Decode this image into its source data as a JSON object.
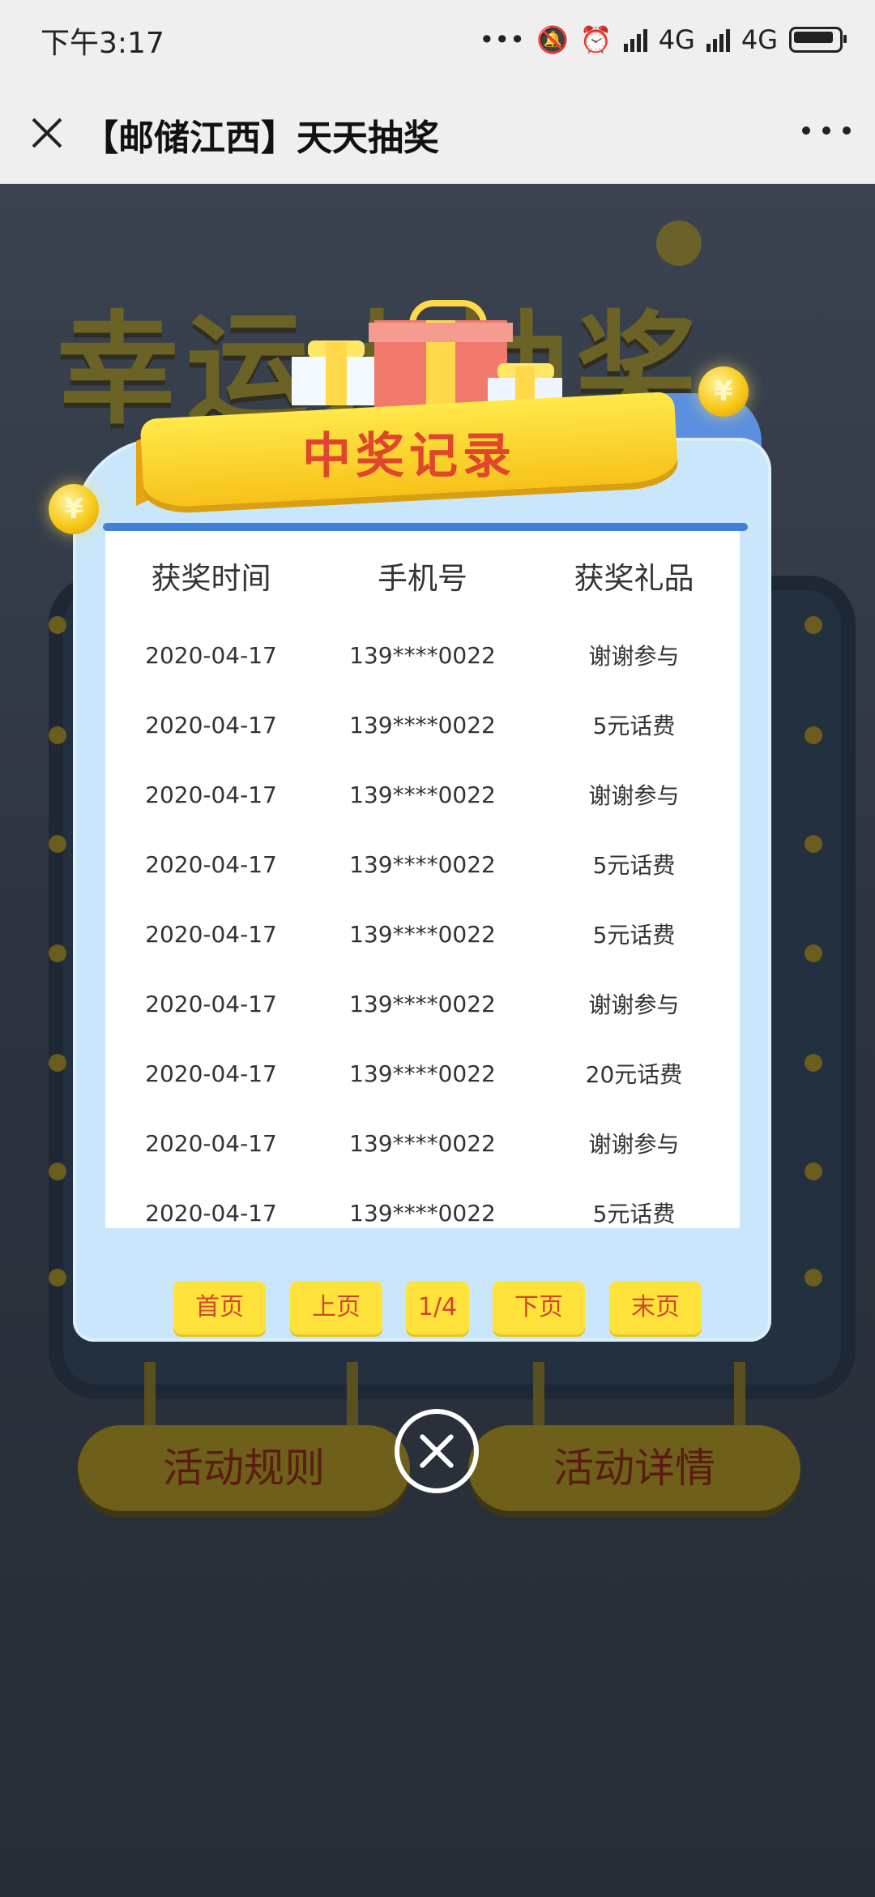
{
  "status_bar": {
    "time": "下午3:17",
    "network_1": "4G",
    "network_2": "4G"
  },
  "title_bar": {
    "title": "【邮储江西】天天抽奖"
  },
  "background": {
    "headline": "幸运大抽奖",
    "left_button": "活动规则",
    "right_button": "活动详情"
  },
  "modal": {
    "ribbon_title": "中奖记录",
    "columns": [
      "获奖时间",
      "手机号",
      "获奖礼品"
    ],
    "rows": [
      [
        "2020-04-17",
        "139****0022",
        "谢谢参与"
      ],
      [
        "2020-04-17",
        "139****0022",
        "5元话费"
      ],
      [
        "2020-04-17",
        "139****0022",
        "谢谢参与"
      ],
      [
        "2020-04-17",
        "139****0022",
        "5元话费"
      ],
      [
        "2020-04-17",
        "139****0022",
        "5元话费"
      ],
      [
        "2020-04-17",
        "139****0022",
        "谢谢参与"
      ],
      [
        "2020-04-17",
        "139****0022",
        "20元话费"
      ],
      [
        "2020-04-17",
        "139****0022",
        "谢谢参与"
      ],
      [
        "2020-04-17",
        "139****0022",
        "5元话费"
      ]
    ],
    "pager": {
      "first": "首页",
      "prev": "上页",
      "page": "1/4",
      "next": "下页",
      "last": "末页"
    },
    "coin_symbol": "¥"
  },
  "colors": {
    "accent_yellow": "#ffe33c",
    "accent_red": "#d2472b",
    "panel_blue": "#c9e6fb"
  }
}
